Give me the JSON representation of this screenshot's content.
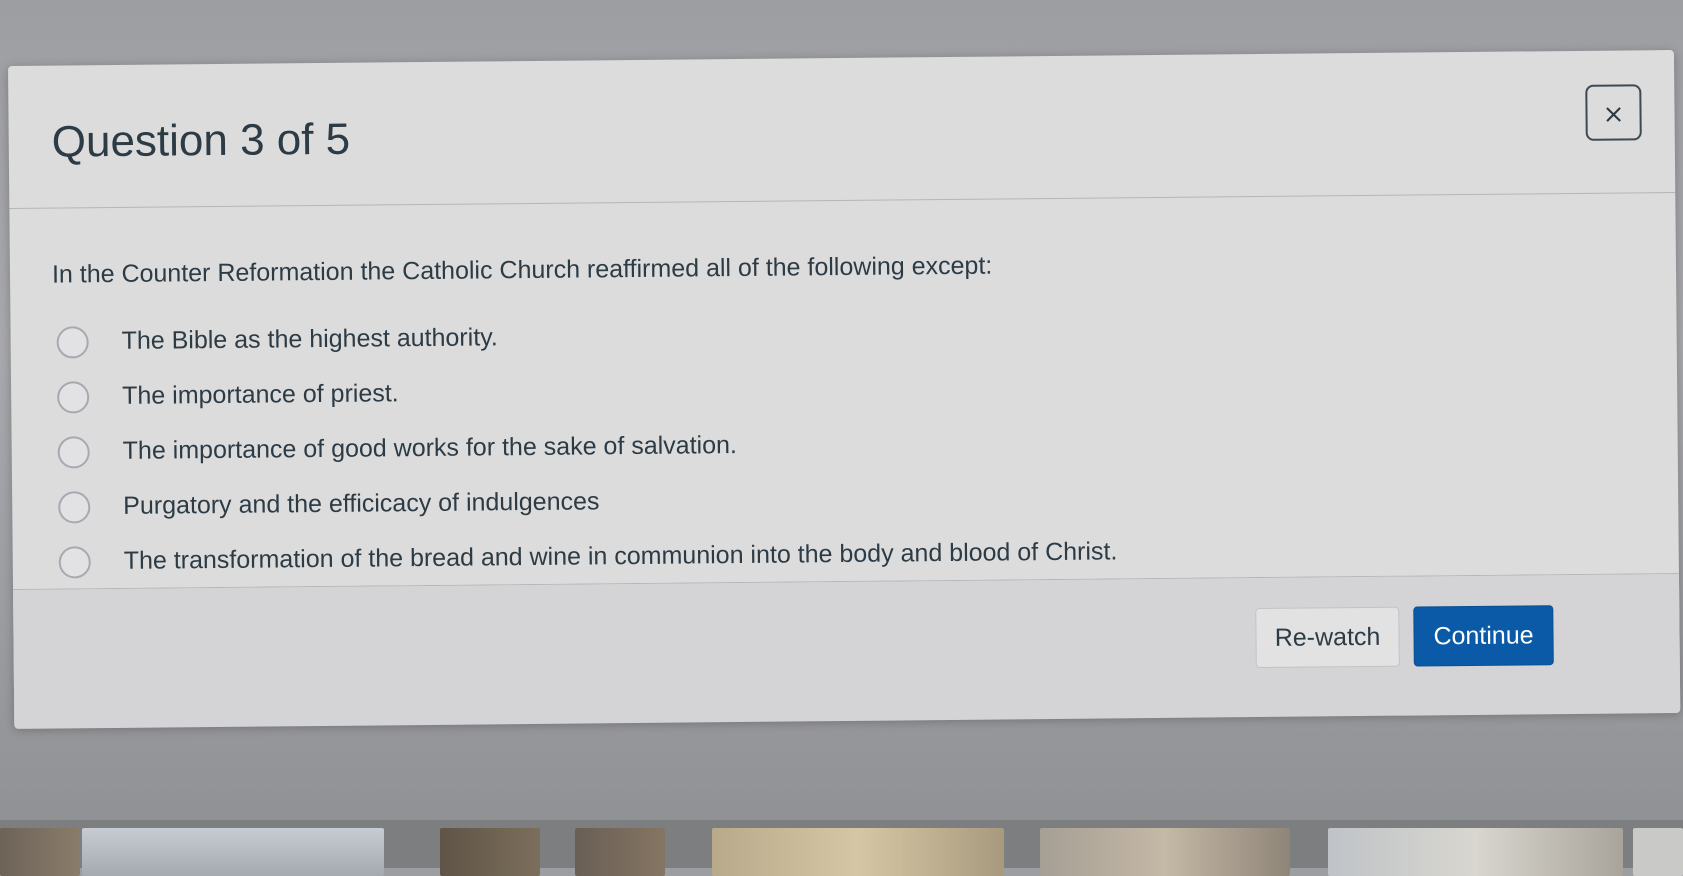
{
  "dialog": {
    "title": "Question 3 of 5",
    "close_icon": "×"
  },
  "quiz": {
    "question": "In the Counter Reformation the Catholic Church reaffirmed all of the following except:",
    "answers": [
      {
        "label": "The Bible as the highest authority.",
        "selected": false
      },
      {
        "label": "The importance of priest.",
        "selected": false
      },
      {
        "label": "The importance of good works for the sake of salvation.",
        "selected": false
      },
      {
        "label": "Purgatory and the efficicacy of indulgences",
        "selected": false
      },
      {
        "label": "The transformation of the bread and wine in communion into the body and blood of Christ.",
        "selected": false
      }
    ]
  },
  "footer": {
    "rewatch_label": "Re-watch",
    "continue_label": "Continue"
  },
  "colors": {
    "primary": "#0b5aa8",
    "text": "#2d3b45",
    "dialog_bg": "#dcdcdd"
  },
  "icons": {
    "close": "close-icon"
  }
}
